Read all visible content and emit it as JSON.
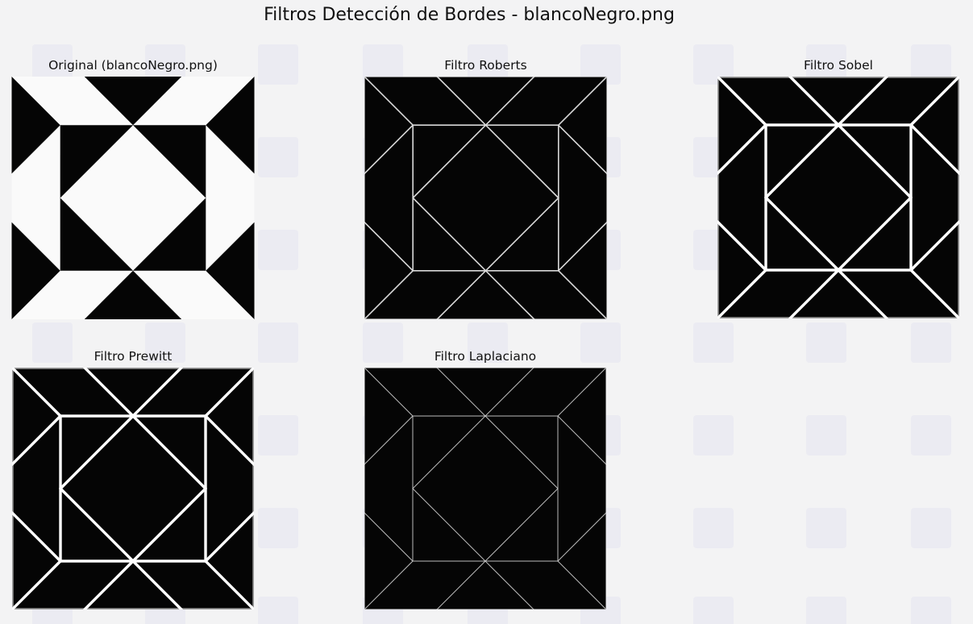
{
  "window": {
    "suptitle": "Filtros Detección de Bordes - blancoNegro.png"
  },
  "panels": [
    {
      "id": "original",
      "title": "Original (blancoNegro.png)",
      "kind": "original"
    },
    {
      "id": "roberts",
      "title": "Filtro Roberts",
      "kind": "edges-thin"
    },
    {
      "id": "sobel",
      "title": "Filtro Sobel",
      "kind": "edges-thick"
    },
    {
      "id": "prewitt",
      "title": "Filtro Prewitt",
      "kind": "edges-thick"
    },
    {
      "id": "laplace",
      "title": "Filtro Laplaciano",
      "kind": "edges-fine"
    }
  ],
  "colors": {
    "background": "#f3f3f4",
    "image_black": "#050505",
    "image_white": "#fafafa",
    "edge_white": "#ffffff"
  }
}
